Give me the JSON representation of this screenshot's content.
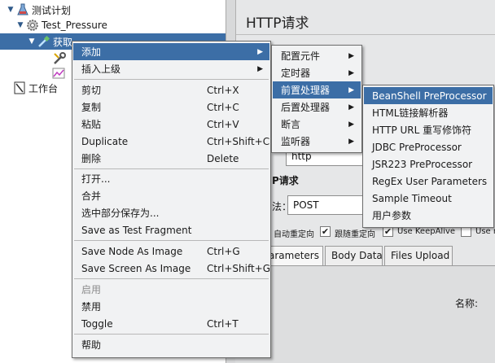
{
  "tree": {
    "items": [
      {
        "label": "测试计划",
        "icon": "flask-icon"
      },
      {
        "label": "Test_Pressure",
        "icon": "gear-icon"
      },
      {
        "label": "获取…",
        "icon": "pipette-icon"
      },
      {
        "label": "",
        "icon": "wrench-icon"
      },
      {
        "label": "",
        "icon": "graph-icon"
      },
      {
        "label": "工作台",
        "icon": "workbench-icon"
      }
    ]
  },
  "panel": {
    "title": "HTTP请求",
    "path_value": "http",
    "section_label": "P请求",
    "method_label": "法：",
    "method_value": "POST",
    "name_label": "名称:",
    "checkboxes": [
      {
        "label": "自动重定向",
        "checked": false
      },
      {
        "label": "跟随重定向",
        "checked": true
      },
      {
        "label": "Use KeepAlive",
        "checked": true
      },
      {
        "label": "Use m",
        "checked": false
      }
    ],
    "tabs": [
      "arameters",
      "Body Data",
      "Files Upload"
    ]
  },
  "context_menu": {
    "items": [
      {
        "label": "添加",
        "accel": "",
        "submenu": true,
        "highlight": true
      },
      {
        "label": "插入上级",
        "accel": "",
        "submenu": true
      },
      {
        "sep": true
      },
      {
        "label": "剪切",
        "accel": "Ctrl+X"
      },
      {
        "label": "复制",
        "accel": "Ctrl+C"
      },
      {
        "label": "粘贴",
        "accel": "Ctrl+V"
      },
      {
        "label": "Duplicate",
        "accel": "Ctrl+Shift+C"
      },
      {
        "label": "删除",
        "accel": "Delete"
      },
      {
        "sep": true
      },
      {
        "label": "打开...",
        "accel": ""
      },
      {
        "label": "合并",
        "accel": ""
      },
      {
        "label": "选中部分保存为...",
        "accel": ""
      },
      {
        "label": "Save as Test Fragment",
        "accel": ""
      },
      {
        "sep": true
      },
      {
        "label": "Save Node As Image",
        "accel": "Ctrl+G"
      },
      {
        "label": "Save Screen As Image",
        "accel": "Ctrl+Shift+G"
      },
      {
        "sep": true
      },
      {
        "label": "启用",
        "accel": "",
        "disabled": true
      },
      {
        "label": "禁用",
        "accel": ""
      },
      {
        "label": "Toggle",
        "accel": "Ctrl+T"
      },
      {
        "sep": true
      },
      {
        "label": "帮助",
        "accel": ""
      }
    ]
  },
  "add_submenu": {
    "items": [
      {
        "label": "配置元件",
        "submenu": true
      },
      {
        "label": "定时器",
        "submenu": true
      },
      {
        "label": "前置处理器",
        "submenu": true,
        "highlight": true
      },
      {
        "label": "后置处理器",
        "submenu": true
      },
      {
        "label": "断言",
        "submenu": true
      },
      {
        "label": "监听器",
        "submenu": true
      }
    ]
  },
  "preprocessor_submenu": {
    "items": [
      {
        "label": "BeanShell PreProcessor",
        "highlight": true
      },
      {
        "label": "HTML链接解析器"
      },
      {
        "label": "HTTP URL 重写修饰符"
      },
      {
        "label": "JDBC PreProcessor"
      },
      {
        "label": "JSR223 PreProcessor"
      },
      {
        "label": "RegEx User Parameters"
      },
      {
        "label": "Sample Timeout"
      },
      {
        "label": "用户参数"
      }
    ]
  },
  "colors": {
    "highlight": "#3c6ea6",
    "menu_bg": "#f1f2f3",
    "panel_bg": "#e6e7e8"
  }
}
